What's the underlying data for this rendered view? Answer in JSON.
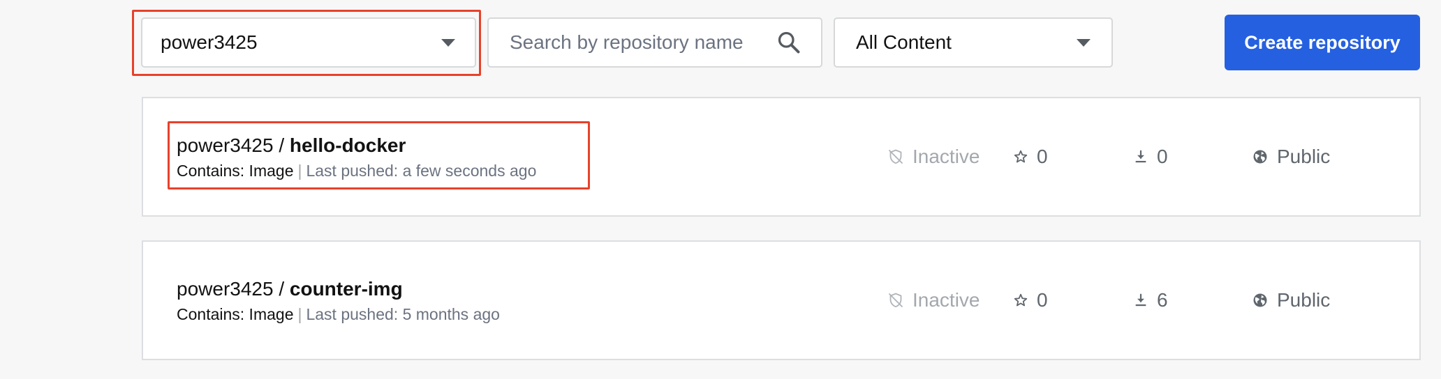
{
  "toolbar": {
    "namespace_select": {
      "value": "power3425",
      "icon": "chevron-down-icon"
    },
    "search": {
      "placeholder": "Search by repository name",
      "icon": "search-icon"
    },
    "content_filter": {
      "value": "All Content",
      "icon": "chevron-down-icon"
    },
    "create_button": {
      "label": "Create repository",
      "color": "#2560e0"
    }
  },
  "highlight_color": "#e8412b",
  "repositories": [
    {
      "namespace": "power3425",
      "separator": " / ",
      "name": "hello-docker",
      "contains": "Contains: Image",
      "meta_separator": "|",
      "last_pushed": "Last pushed: a few seconds ago",
      "status": "Inactive",
      "stars": "0",
      "pulls": "0",
      "visibility": "Public"
    },
    {
      "namespace": "power3425",
      "separator": " / ",
      "name": "counter-img",
      "contains": "Contains: Image",
      "meta_separator": "|",
      "last_pushed": "Last pushed: 5 months ago",
      "status": "Inactive",
      "stars": "0",
      "pulls": "6",
      "visibility": "Public"
    }
  ],
  "icons": {
    "status": "inactive-shield-icon",
    "stars": "star-icon",
    "pulls": "download-icon",
    "visibility": "globe-icon"
  }
}
